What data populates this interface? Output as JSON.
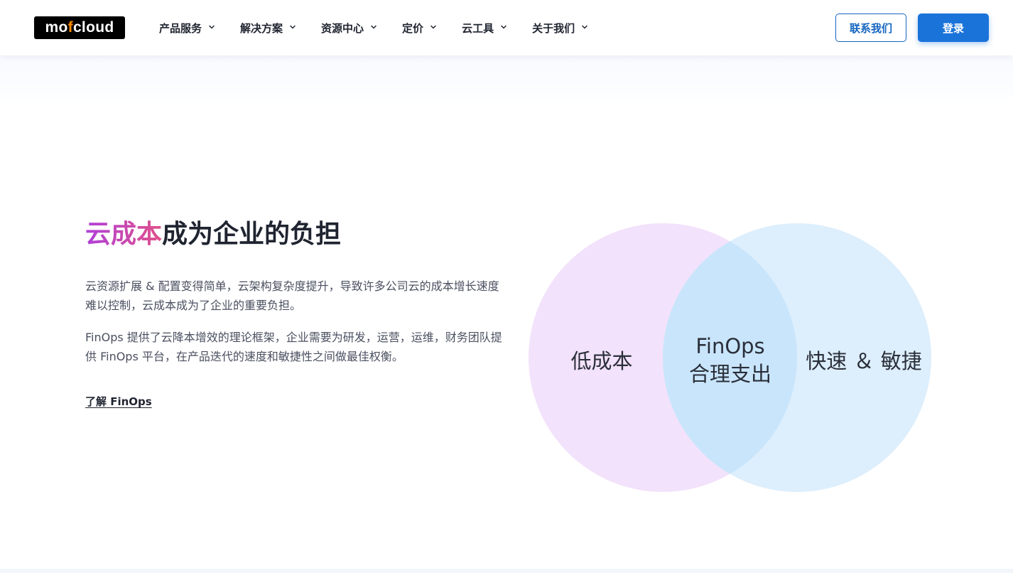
{
  "navbar": {
    "logo": {
      "prefix": "mo",
      "accent": "f",
      "suffix": "cloud"
    },
    "menu": [
      {
        "label": "产品服务"
      },
      {
        "label": "解决方案"
      },
      {
        "label": "资源中心"
      },
      {
        "label": "定价"
      },
      {
        "label": "云工具"
      },
      {
        "label": "关于我们"
      }
    ],
    "contact_label": "联系我们",
    "login_label": "登录"
  },
  "hero": {
    "heading_highlight": "云成本",
    "heading_rest": "成为企业的负担",
    "paragraph1": "云资源扩展 & 配置变得简单，云架构复杂度提升，导致许多公司云的成本增长速度难以控制，云成本成为了企业的重要负担。",
    "paragraph2": "FinOps 提供了云降本增效的理论框架，企业需要为研发，运营，运维，财务团队提供 FinOps 平台，在产品迭代的速度和敏捷性之间做最佳权衡。",
    "link_label": "了解 FinOps"
  },
  "venn": {
    "left_label": "低成本",
    "center_line1": "FinOps",
    "center_line2": "合理支出",
    "right_label": "快速 ＆ 敏捷"
  },
  "colors": {
    "brand_blue": "#1a73d9",
    "logo_accent": "#ff8a00",
    "heading_gradient_start": "#b040d8",
    "heading_gradient_end": "#e0508a",
    "venn_left": "#f3e2fb",
    "venn_right": "#ddeefc",
    "venn_overlap": "#c9e5fb"
  }
}
